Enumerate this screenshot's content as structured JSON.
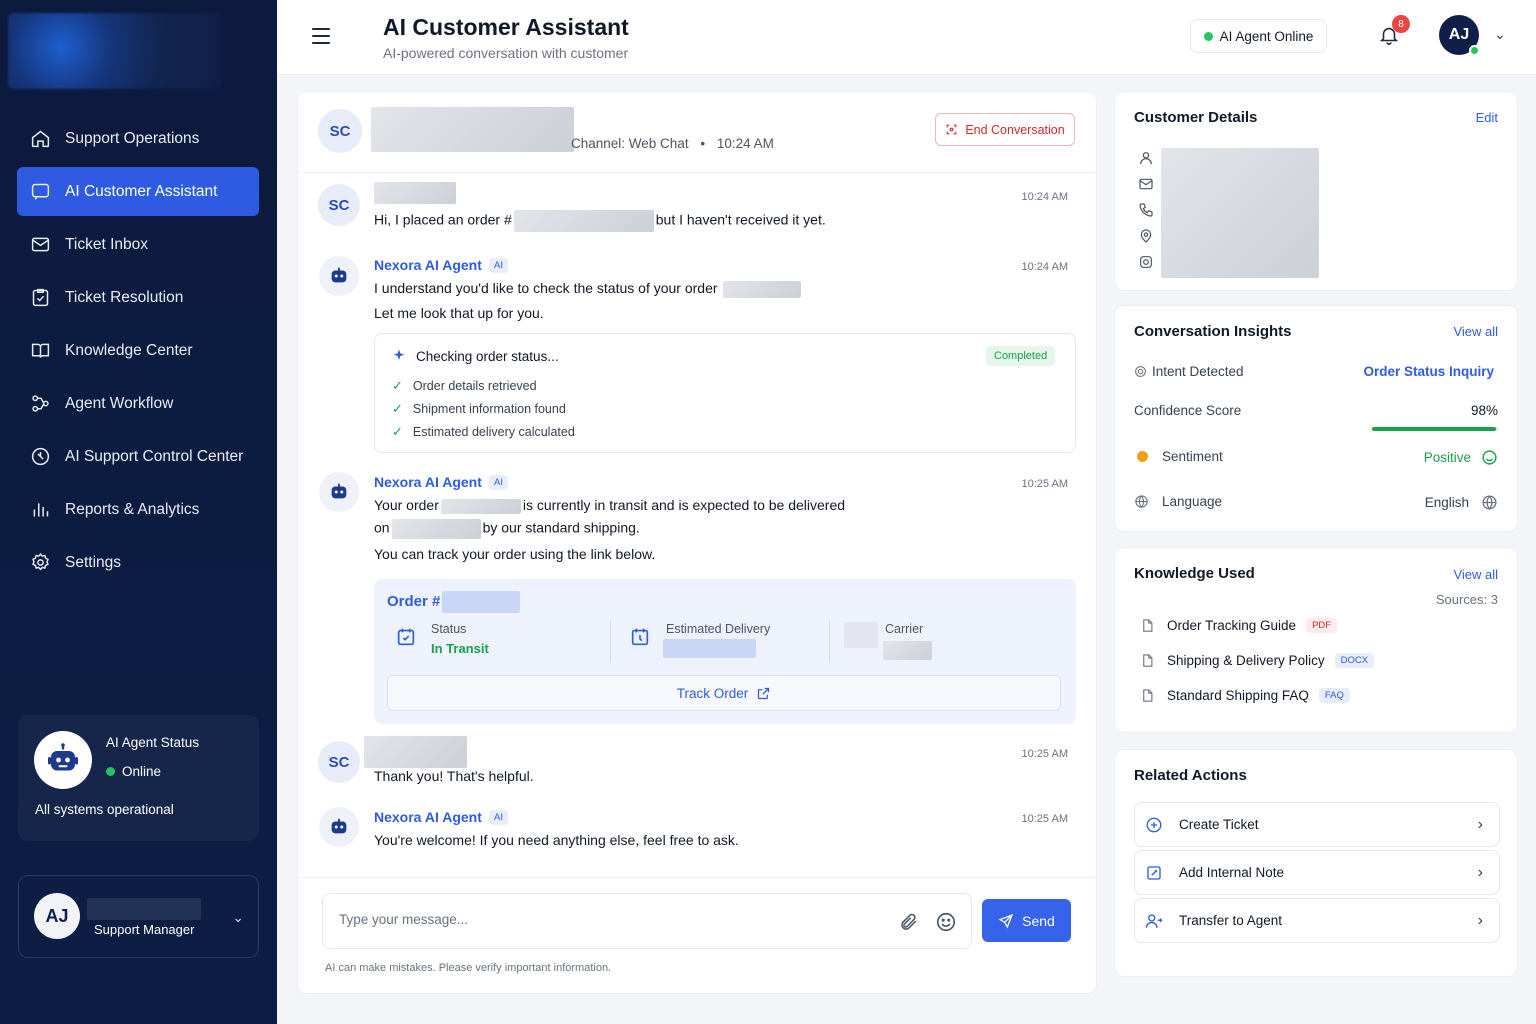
{
  "sidebar": {
    "items": [
      {
        "label": "Support Operations",
        "icon": "home-icon"
      },
      {
        "label": "AI Customer Assistant",
        "icon": "chat-icon",
        "active": true
      },
      {
        "label": "Ticket Inbox",
        "icon": "inbox-icon"
      },
      {
        "label": "Ticket Resolution",
        "icon": "clipboard-check-icon"
      },
      {
        "label": "Knowledge Center",
        "icon": "book-icon"
      },
      {
        "label": "Agent Workflow",
        "icon": "workflow-icon"
      },
      {
        "label": "AI Support Control Center",
        "icon": "control-icon"
      },
      {
        "label": "Reports & Analytics",
        "icon": "bar-chart-icon"
      },
      {
        "label": "Settings",
        "icon": "gear-icon"
      }
    ],
    "status_card": {
      "title": "AI Agent Status",
      "status": "Online",
      "message": "All systems operational"
    },
    "user": {
      "initials": "AJ",
      "role": "Support Manager"
    }
  },
  "header": {
    "title": "AI Customer Assistant",
    "subtitle": "AI-powered conversation with customer",
    "agent_status": "AI Agent Online",
    "notification_count": "8",
    "avatar_initials": "AJ"
  },
  "chat": {
    "customer_initials": "SC",
    "channel": "Channel: Web Chat",
    "started": "10:24 AM",
    "end_label": "End Conversation",
    "messages": [
      {
        "time": "10:24 AM",
        "text_a": "Hi, I placed an order #",
        "text_b": "but I haven't received it yet."
      },
      {
        "sender": "Nexora AI Agent",
        "tag": "AI",
        "time": "10:24 AM",
        "line1": "I understand you'd like to check the status of your order",
        "line2": "Let me look that up for you."
      },
      {
        "sender": "Nexora AI Agent",
        "tag": "AI",
        "time": "10:25 AM",
        "line1a": "Your order",
        "line1b": "is currently in transit and is expected to be delivered",
        "line2a": "on",
        "line2b": "by our standard shipping.",
        "line3": "You can track your order using the link below."
      },
      {
        "time": "10:25 AM",
        "text": "Thank you! That's helpful."
      },
      {
        "sender": "Nexora AI Agent",
        "tag": "AI",
        "time": "10:25 AM",
        "text": "You're welcome! If you need anything else, feel free to ask."
      }
    ],
    "check": {
      "title": "Checking order status...",
      "badge": "Completed",
      "steps": [
        "Order details retrieved",
        "Shipment information found",
        "Estimated delivery calculated"
      ]
    },
    "order": {
      "prefix": "Order #",
      "status_label": "Status",
      "status_value": "In Transit",
      "delivery_label": "Estimated Delivery",
      "carrier_label": "Carrier",
      "track_label": "Track Order"
    },
    "input_placeholder": "Type your message...",
    "send_label": "Send",
    "disclaimer": "AI can make mistakes. Please verify important information."
  },
  "customer_details": {
    "title": "Customer Details",
    "edit": "Edit"
  },
  "insights": {
    "title": "Conversation Insights",
    "view_all": "View all",
    "intent_label": "Intent Detected",
    "intent_value": "Order Status Inquiry",
    "confidence_label": "Confidence Score",
    "confidence_value": "98%",
    "confidence_fraction": 0.98,
    "sentiment_label": "Sentiment",
    "sentiment_value": "Positive",
    "language_label": "Language",
    "language_value": "English"
  },
  "knowledge": {
    "title": "Knowledge Used",
    "view_all": "View all",
    "sources": "Sources: 3",
    "items": [
      {
        "name": "Order Tracking Guide",
        "type": "PDF"
      },
      {
        "name": "Shipping & Delivery Policy",
        "type": "DOCX"
      },
      {
        "name": "Standard Shipping FAQ",
        "type": "FAQ"
      }
    ]
  },
  "related_actions": {
    "title": "Related Actions",
    "items": [
      {
        "label": "Create Ticket",
        "icon": "plus-circle-icon"
      },
      {
        "label": "Add Internal Note",
        "icon": "note-icon"
      },
      {
        "label": "Transfer to Agent",
        "icon": "user-transfer-icon"
      }
    ]
  },
  "colors": {
    "accent": "#2f5be3",
    "sidebar": "#0b1a3d",
    "success": "#16a34a",
    "danger": "#dc2626"
  }
}
